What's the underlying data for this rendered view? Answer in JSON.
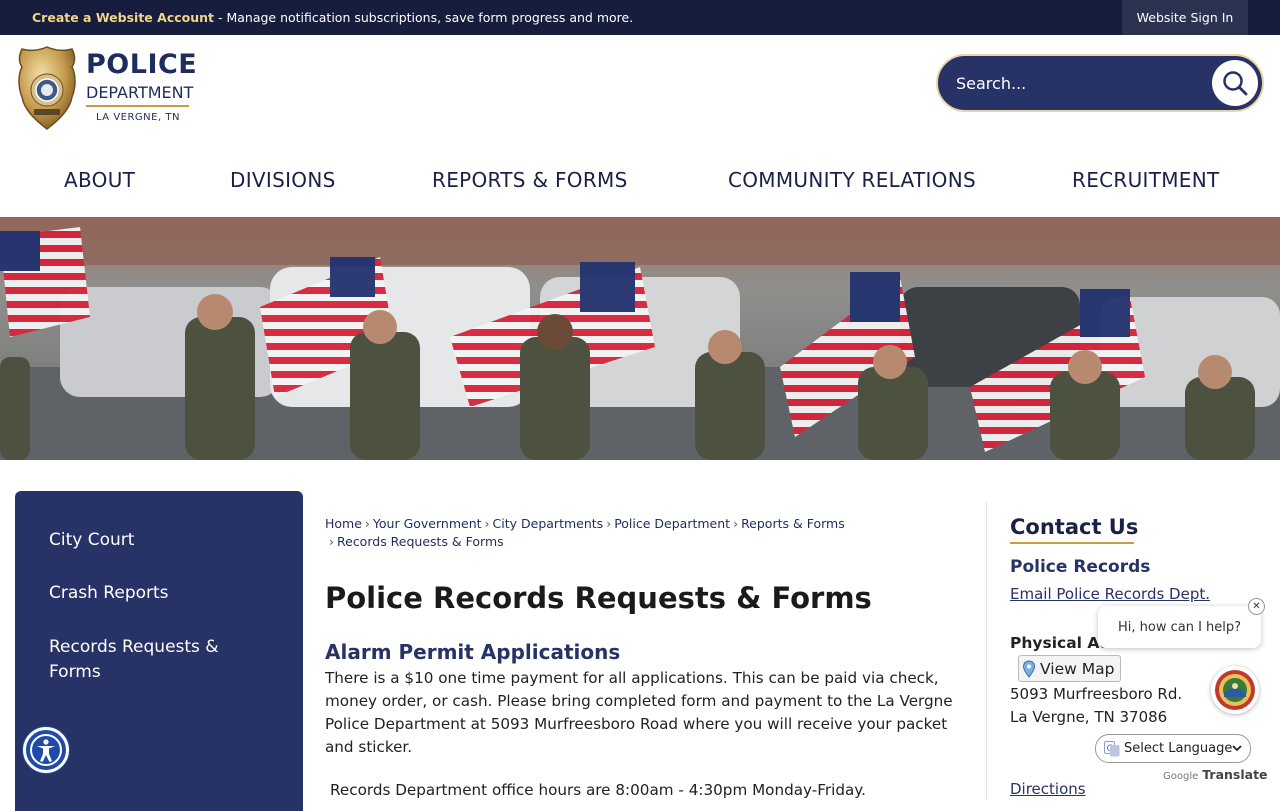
{
  "topbar": {
    "create_account": "Create a Website Account",
    "message": " - Manage notification subscriptions, save form progress and more.",
    "signin": "Website Sign In"
  },
  "logo": {
    "line1": "POLICE",
    "line2": "DEPARTMENT",
    "line3": "LA VERGNE, TN"
  },
  "search": {
    "placeholder": "Search..."
  },
  "nav": {
    "items": [
      "ABOUT",
      "DIVISIONS",
      "REPORTS & FORMS",
      "COMMUNITY RELATIONS",
      "RECRUITMENT"
    ]
  },
  "sidebar": {
    "items": [
      "City Court",
      "Crash Reports",
      "Records Requests & Forms"
    ]
  },
  "breadcrumb": {
    "items": [
      "Home",
      "Your Government",
      "City Departments",
      "Police Department",
      "Reports & Forms",
      "Records Requests & Forms"
    ]
  },
  "page": {
    "title": "Police Records Requests & Forms",
    "section_title": "Alarm Permit Applications",
    "paragraph1": "There is a $10 one time payment for all applications. This can be paid via check, money order, or cash. Please bring completed form and payment to the La Vergne Police Department at 5093 Murfreesboro Road where you will receive your packet and sticker.",
    "paragraph2": "Records Department office hours are 8:00am - 4:30pm Monday-Friday."
  },
  "contact": {
    "title": "Contact Us",
    "subtitle": "Police Records",
    "email_link": "Email Police Records Dept.",
    "address_label": "Physical Ad",
    "view_map": "View Map",
    "address_line1": "5093 Murfreesboro Rd.",
    "address_line2": "La Vergne, TN 37086",
    "directions": "Directions"
  },
  "chat": {
    "greeting": "Hi, how can I help?",
    "close": "✕"
  },
  "translate": {
    "select_label": "Select Language",
    "powered_by": "Google",
    "translate_word": "Translate"
  },
  "colors": {
    "navy": "#273267",
    "topbar": "#161d3d",
    "gold": "#c89c45"
  }
}
